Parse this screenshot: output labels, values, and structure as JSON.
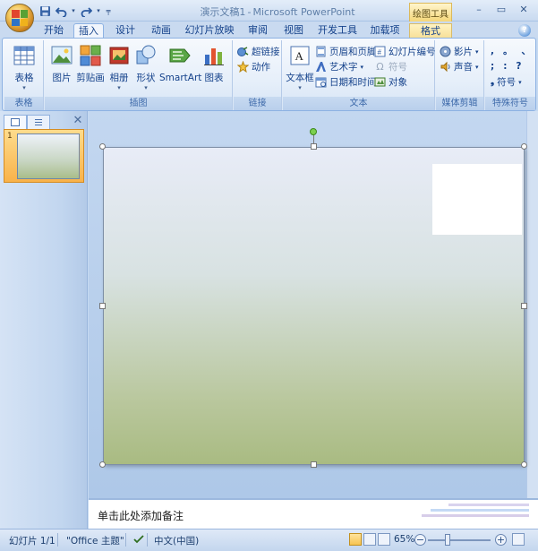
{
  "app": {
    "title": "演示文稿1",
    "app_name": "Microsoft PowerPoint",
    "contextual_group": "绘图工具"
  },
  "qat": {
    "icons": [
      "save-icon",
      "undo-icon",
      "redo-icon",
      "customize-icon"
    ]
  },
  "tabs": [
    {
      "label": "开始"
    },
    {
      "label": "插入",
      "active": true
    },
    {
      "label": "设计"
    },
    {
      "label": "动画"
    },
    {
      "label": "幻灯片放映"
    },
    {
      "label": "审阅"
    },
    {
      "label": "视图"
    },
    {
      "label": "开发工具"
    },
    {
      "label": "加载项"
    },
    {
      "label": "格式",
      "contextual": true
    }
  ],
  "ribbon": {
    "tables": {
      "label": "表格",
      "table_btn": "表格"
    },
    "illustrations": {
      "label": "插图",
      "picture": "图片",
      "clipart": "剪贴画",
      "album": "相册",
      "shapes": "形状",
      "smartart": "SmartArt",
      "chart": "图表"
    },
    "links": {
      "label": "链接",
      "hyperlink": "超链接",
      "action": "动作"
    },
    "text": {
      "label": "文本",
      "textbox": "文本框",
      "header_footer": "页眉和页脚",
      "wordart": "艺术字",
      "datetime": "日期和时间",
      "slide_number": "幻灯片编号",
      "symbol": "符号",
      "object": "对象"
    },
    "media": {
      "label": "媒体剪辑",
      "movie": "影片",
      "sound": "声音"
    },
    "special": {
      "label": "特殊符号",
      "symbols": [
        ",",
        "。",
        "、",
        ";",
        ":",
        "?"
      ],
      "symbol_btn": "符号"
    }
  },
  "slides_pane": {
    "slide_number": "1"
  },
  "notes": {
    "placeholder": "单击此处添加备注"
  },
  "status": {
    "slide": "幻灯片 1/1",
    "theme": "\"Office 主题\"",
    "language": "中文(中国)",
    "zoom": "65%",
    "zoom_fraction": 0.65
  },
  "colors": {
    "accent": "#15428b",
    "ribbon_bg": "#dbe6f5",
    "thumb_selected": "#f9b24a"
  }
}
